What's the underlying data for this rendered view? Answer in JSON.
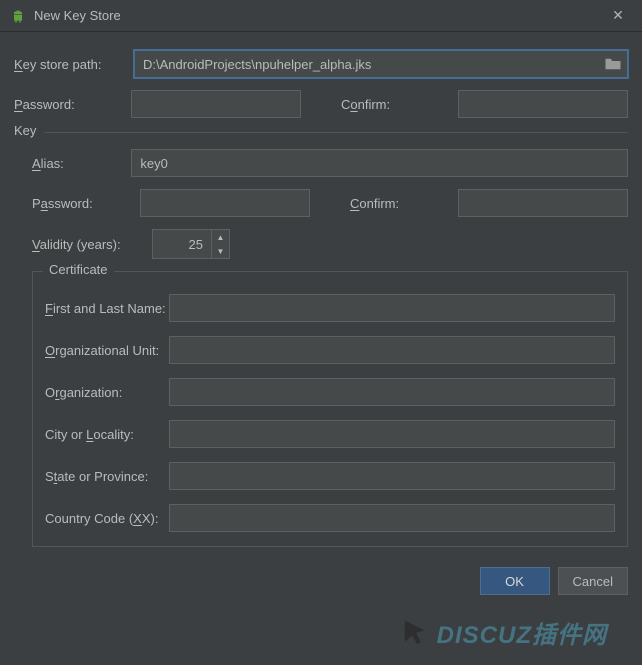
{
  "titlebar": {
    "title": "New Key Store"
  },
  "labels": {
    "key_store_path": "Key store path:",
    "password": "Password:",
    "confirm": "Confirm:",
    "key_section": "Key",
    "alias": "Alias:",
    "key_password": "Password:",
    "key_confirm": "Confirm:",
    "validity": "Validity (years):",
    "certificate": "Certificate",
    "first_last": "First and Last Name:",
    "org_unit": "Organizational Unit:",
    "organization": "Organization:",
    "city": "City or Locality:",
    "state": "State or Province:",
    "country": "Country Code (XX):"
  },
  "values": {
    "key_store_path": "D:\\AndroidProjects\\npuhelper_alpha.jks",
    "password": "",
    "confirm": "",
    "alias": "key0",
    "key_password": "",
    "key_confirm": "",
    "validity": "25",
    "first_last": "",
    "org_unit": "",
    "organization": "",
    "city": "",
    "state": "",
    "country": ""
  },
  "buttons": {
    "ok": "OK",
    "cancel": "Cancel"
  },
  "watermark": {
    "text": "DISCUZ插件网"
  }
}
